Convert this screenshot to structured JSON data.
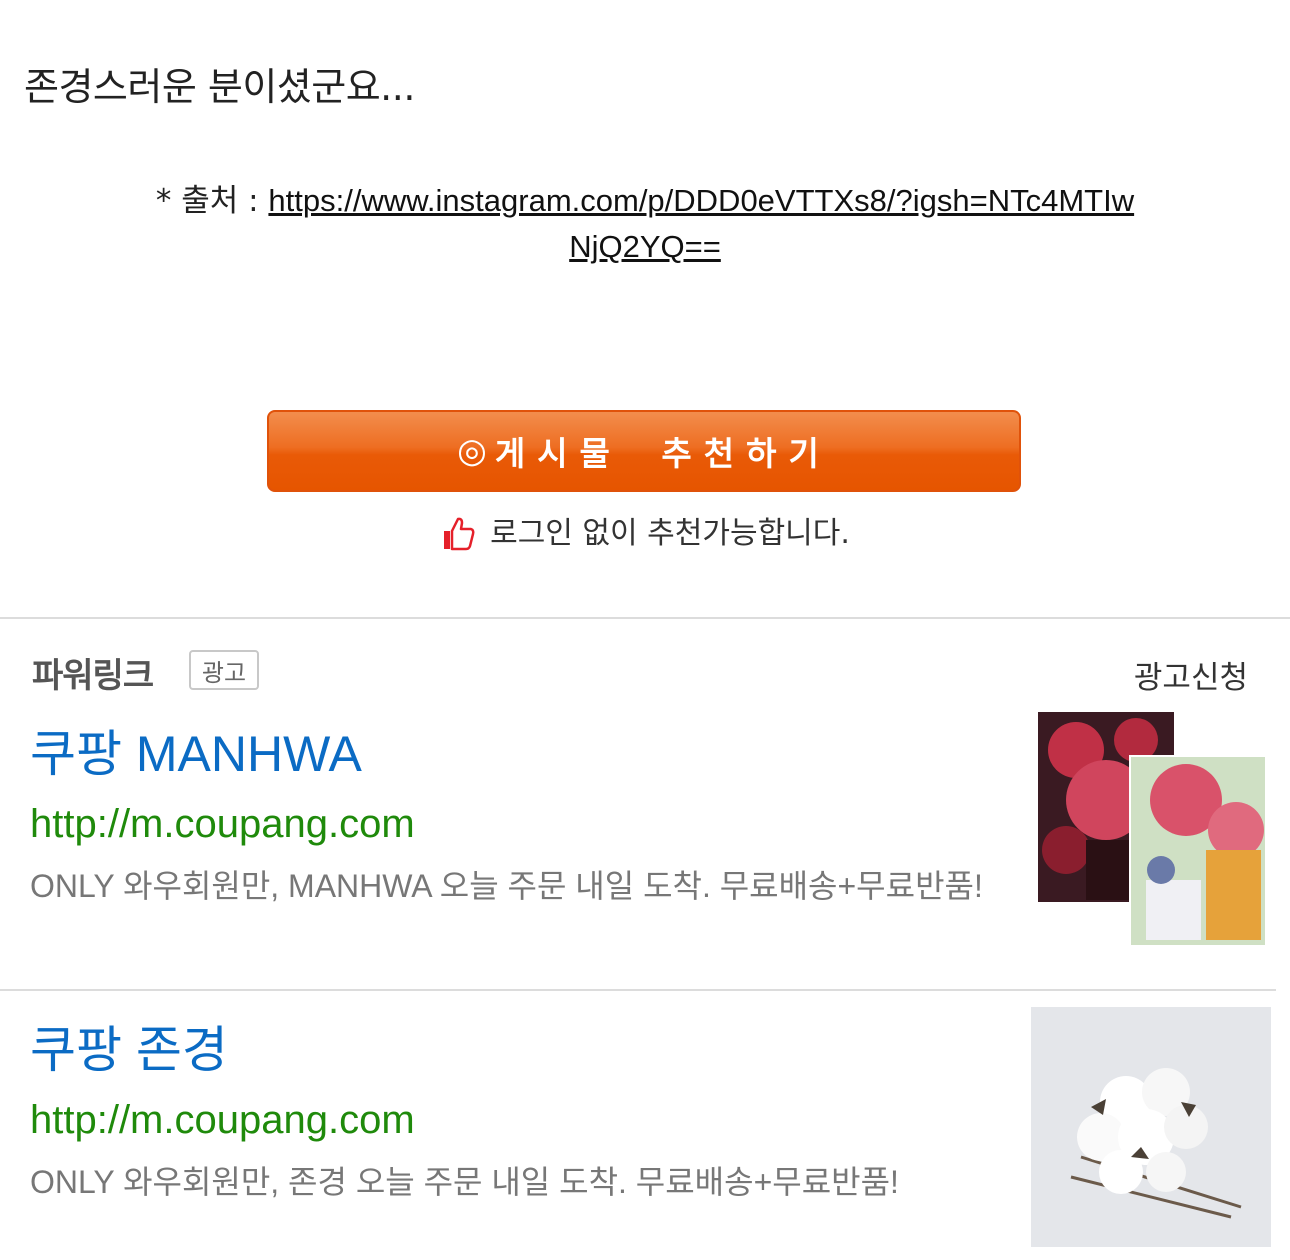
{
  "post": {
    "text": "존경스러운 분이셨군요..."
  },
  "source": {
    "label": "* 출처 : ",
    "link_line1": "https://www.instagram.com/p/DDD0eVTTXs8/?igsh=NTc4MTIw",
    "link_line2": "NjQ2YQ=="
  },
  "recommend": {
    "icon": "◎",
    "label": "게시물 추천하기",
    "nologin_text": "로그인 없이 추천가능합니다.",
    "icon_name": "thumbs-up-icon",
    "icon_color": "#e5202a"
  },
  "powerlink": {
    "title": "파워링크",
    "badge": "광고",
    "apply_label": "광고신청"
  },
  "ads": [
    {
      "title": "쿠팡 MANHWA",
      "url": "http://m.coupang.com",
      "desc": "ONLY 와우회원만, MANHWA 오늘 주문 내일 도착. 무료배송+무료반품!"
    },
    {
      "title": "쿠팡 존경",
      "url": "http://m.coupang.com",
      "desc": "ONLY 와우회원만, 존경 오늘 주문 내일 도착. 무료배송+무료반품!"
    }
  ],
  "colors": {
    "button_orange": "#e95a07",
    "ad_title_blue": "#0b6bc4",
    "ad_url_green": "#1f8a0b"
  }
}
